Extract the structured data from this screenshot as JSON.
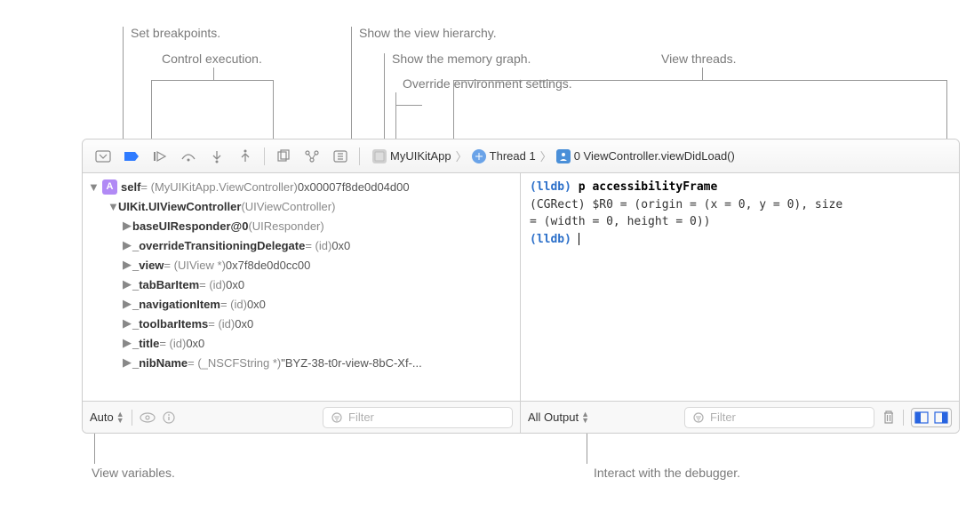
{
  "annotations": {
    "setBreakpoints": "Set breakpoints.",
    "controlExecution": "Control execution.",
    "showViewHierarchy": "Show the view hierarchy.",
    "showMemoryGraph": "Show the memory graph.",
    "overrideEnvironment": "Override environment settings.",
    "viewThreads": "View threads.",
    "viewVariables": "View variables.",
    "interactDebugger": "Interact with the debugger."
  },
  "breadcrumb": {
    "app": "MyUIKitApp",
    "thread": "Thread 1",
    "frame": "0 ViewController.viewDidLoad()"
  },
  "variables": {
    "selfBadge": "A",
    "selfName": "self",
    "selfType": " = (MyUIKitApp.ViewController) ",
    "selfValue": "0x00007f8de0d04d00",
    "rows": [
      {
        "indent": 28,
        "open": true,
        "name": "UIKit.UIViewController",
        "type": " (UIViewController)",
        "val": ""
      },
      {
        "indent": 44,
        "open": false,
        "name": "baseUIResponder@0",
        "type": " (UIResponder)",
        "val": ""
      },
      {
        "indent": 44,
        "open": false,
        "name": "_overrideTransitioningDelegate",
        "type": " = (id) ",
        "val": "0x0"
      },
      {
        "indent": 44,
        "open": false,
        "name": "_view",
        "type": " = (UIView *) ",
        "val": "0x7f8de0d0cc00"
      },
      {
        "indent": 44,
        "open": false,
        "name": "_tabBarItem",
        "type": " = (id) ",
        "val": "0x0"
      },
      {
        "indent": 44,
        "open": false,
        "name": "_navigationItem",
        "type": " = (id) ",
        "val": "0x0"
      },
      {
        "indent": 44,
        "open": false,
        "name": "_toolbarItems",
        "type": " = (id) ",
        "val": "0x0"
      },
      {
        "indent": 44,
        "open": false,
        "name": "_title",
        "type": " = (id) ",
        "val": "0x0"
      },
      {
        "indent": 44,
        "open": false,
        "name": "_nibName",
        "type": " = (_NSCFString *) ",
        "val": "\"BYZ-38-t0r-view-8bC-Xf-..."
      }
    ]
  },
  "console": {
    "prompt": "(lldb)",
    "cmd": "p accessibilityFrame",
    "out1": "(CGRect) $R0 = (origin = (x = 0, y = 0), size",
    "out2": "   = (width = 0, height = 0))"
  },
  "bottomBar": {
    "leftSelector": "Auto",
    "rightSelector": "All Output",
    "filterPlaceholder": "Filter"
  }
}
